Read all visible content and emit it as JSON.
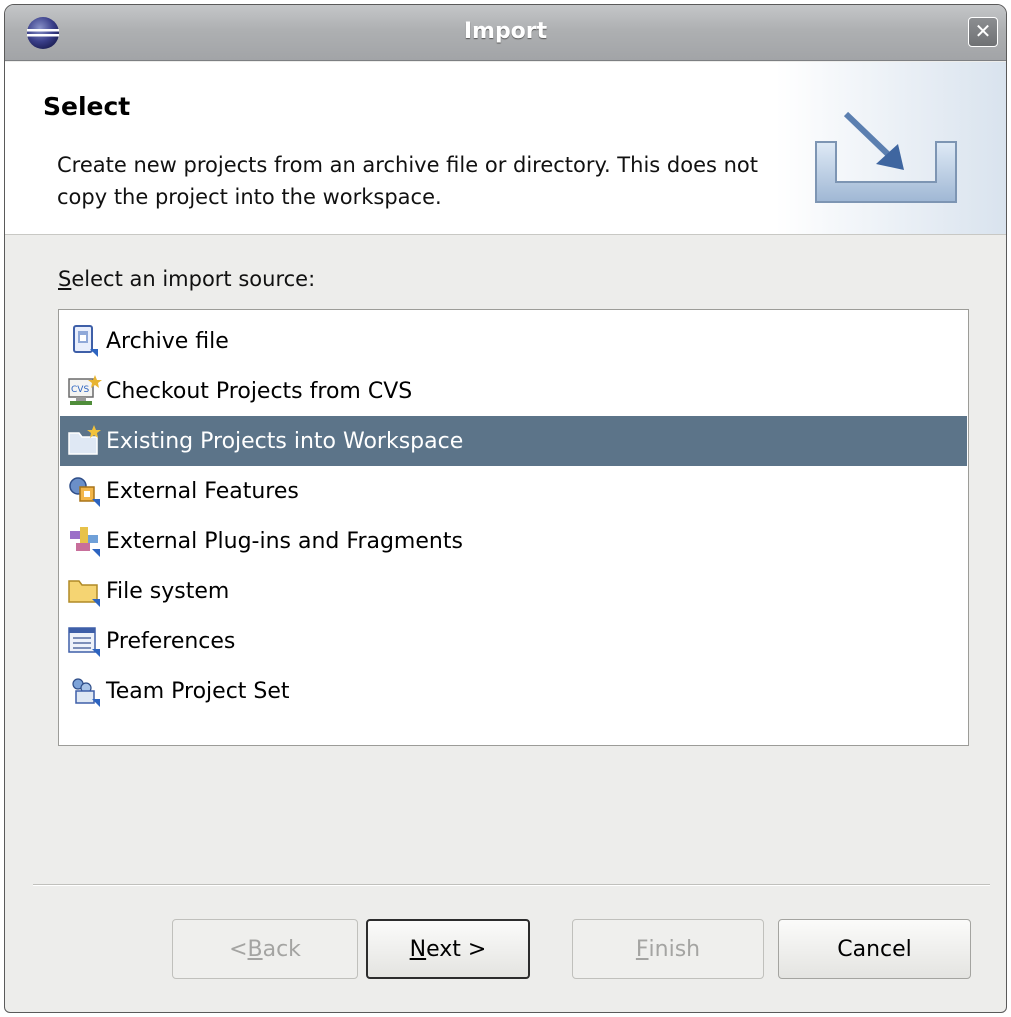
{
  "window": {
    "title": "Import",
    "close_glyph": "✕",
    "icon": "eclipse-icon"
  },
  "banner": {
    "title": "Select",
    "description": "Create new projects from an archive file or directory. This does not copy the project into the workspace.",
    "graphic": "import-wizard-icon"
  },
  "sources": {
    "label_mnemonic": "S",
    "label_rest": "elect an import source:",
    "items": [
      {
        "label": "Archive file",
        "icon": "archive-file-icon",
        "selected": false
      },
      {
        "label": "Checkout Projects from CVS",
        "icon": "cvs-icon",
        "selected": false
      },
      {
        "label": "Existing Projects into Workspace",
        "icon": "existing-project-icon",
        "selected": true
      },
      {
        "label": "External Features",
        "icon": "external-features-icon",
        "selected": false
      },
      {
        "label": "External Plug-ins and Fragments",
        "icon": "external-plugins-icon",
        "selected": false
      },
      {
        "label": "File system",
        "icon": "folder-icon",
        "selected": false
      },
      {
        "label": "Preferences",
        "icon": "preferences-icon",
        "selected": false
      },
      {
        "label": "Team Project Set",
        "icon": "team-project-set-icon",
        "selected": false
      }
    ]
  },
  "buttons": {
    "back": {
      "pre": "< ",
      "mnemonic": "B",
      "rest": "ack",
      "enabled": false
    },
    "next": {
      "pre": "",
      "mnemonic": "N",
      "rest": "ext >",
      "enabled": true
    },
    "finish": {
      "pre": "",
      "mnemonic": "F",
      "rest": "inish",
      "enabled": false
    },
    "cancel": {
      "label": "Cancel",
      "enabled": true
    }
  },
  "colors": {
    "selection": "#5c7489",
    "dialog_bg": "#ededeb"
  }
}
